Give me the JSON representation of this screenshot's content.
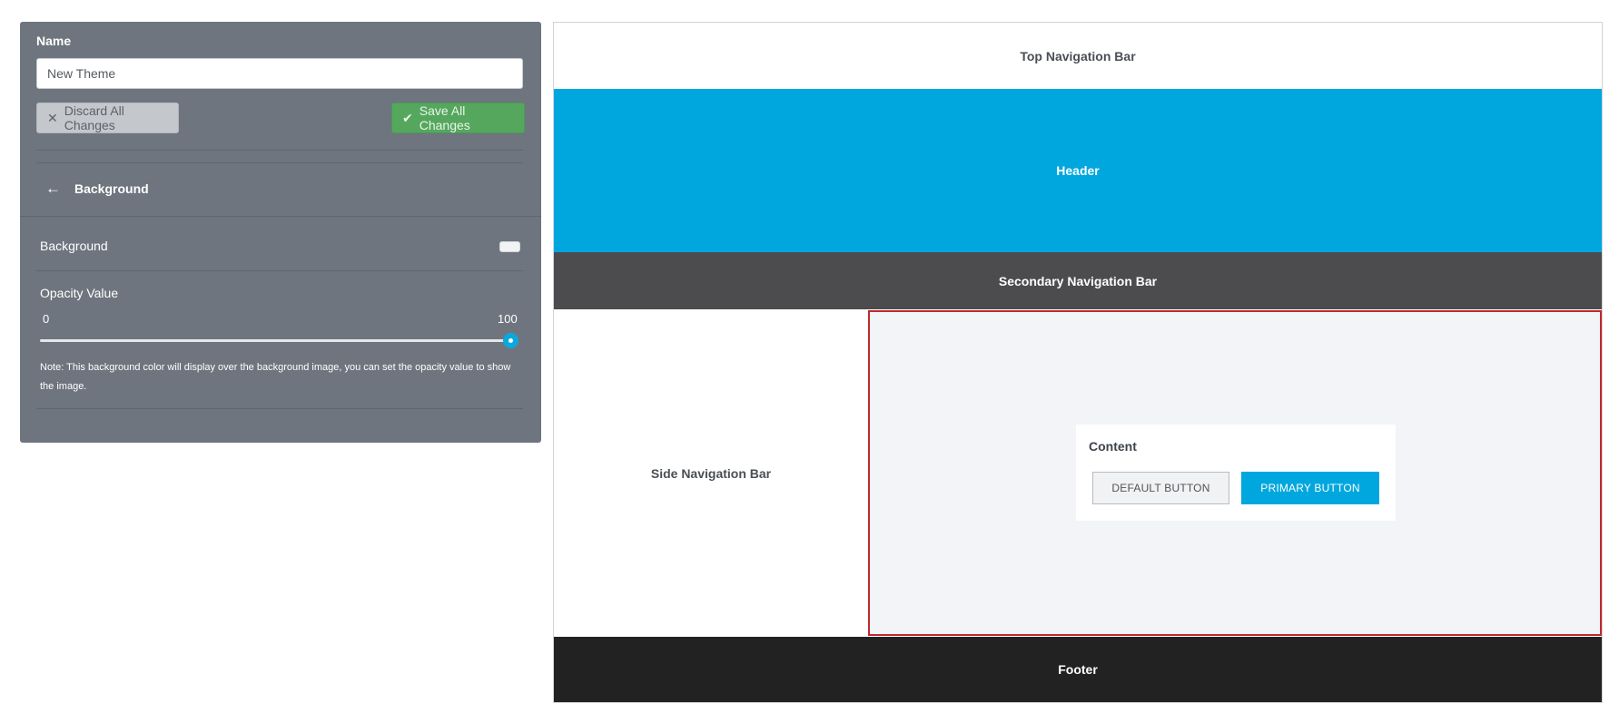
{
  "panel": {
    "name_label": "Name",
    "name_value": "New Theme",
    "discard_label": "Discard All Changes",
    "save_label": "Save All Changes",
    "back_label": "Background",
    "background_label": "Background",
    "background_color": "#f2f3f5",
    "opacity_label": "Opacity Value",
    "opacity_min": "0",
    "opacity_max": "100",
    "opacity_value": 100,
    "note": "Note: This background color will display over the background image, you can set the opacity value to show the image."
  },
  "preview": {
    "top_nav": "Top Navigation Bar",
    "header": "Header",
    "secondary_nav": "Secondary Navigation Bar",
    "side_nav": "Side Navigation Bar",
    "content_title": "Content",
    "default_button": "DEFAULT BUTTON",
    "primary_button": "PRIMARY BUTTON",
    "footer": "Footer"
  },
  "colors": {
    "panel_bg": "#6e757e",
    "header_bg": "#00a7de",
    "secondary_nav_bg": "#4c4c4e",
    "footer_bg": "#222222",
    "save_button": "#55a75e",
    "content_highlight_border": "#c0272d"
  },
  "icons": {
    "discard": "x-icon",
    "save": "check-icon",
    "back": "arrow-left-icon"
  }
}
